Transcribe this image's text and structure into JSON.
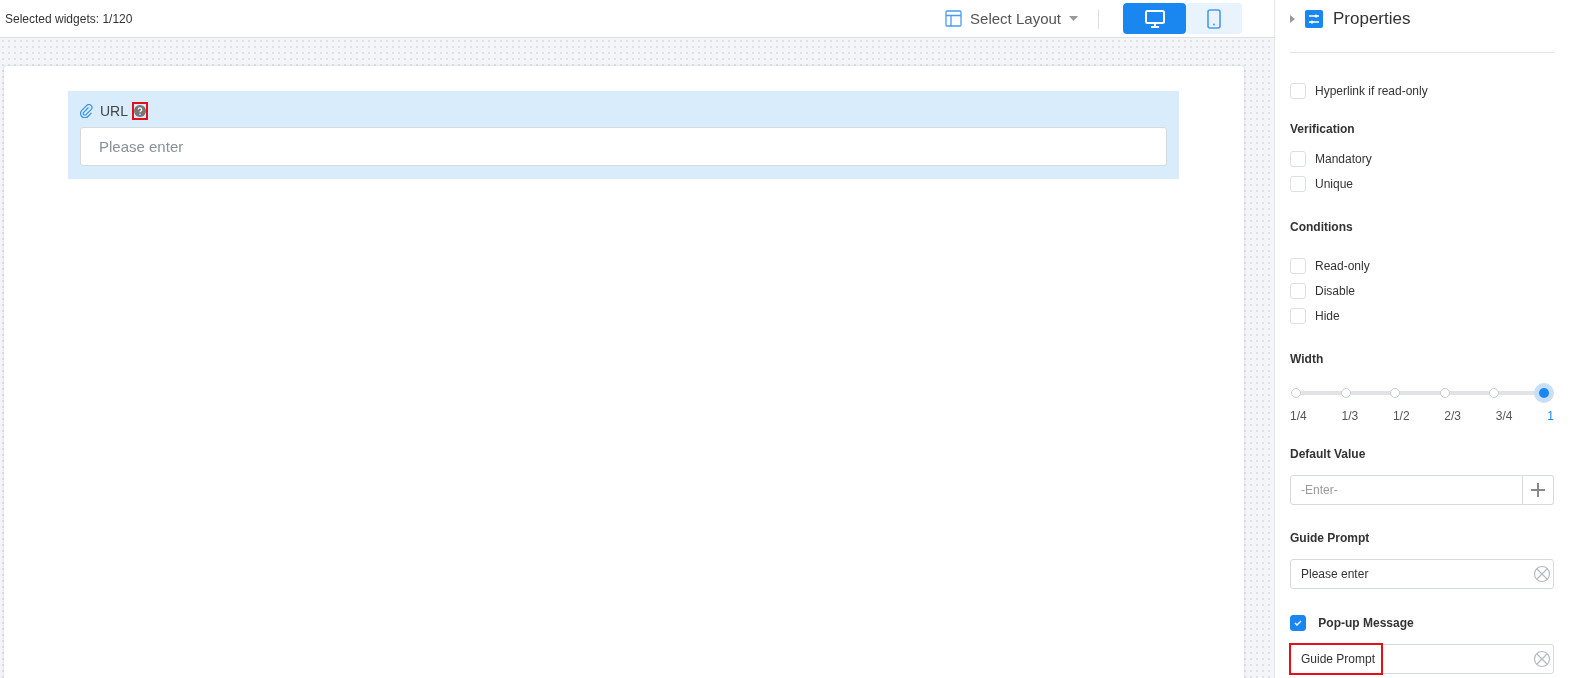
{
  "toolbar": {
    "selection_count": "Selected widgets: 1/120",
    "layout_button": "Select Layout",
    "devices": [
      {
        "kind": "desktop",
        "selected": true
      },
      {
        "kind": "mobile",
        "selected": false
      }
    ]
  },
  "canvas": {
    "field": {
      "label": "URL",
      "help_highlighted": true,
      "placeholder": "Please enter"
    }
  },
  "properties": {
    "title": "Properties",
    "hyperlink": {
      "label": "Hyperlink if read-only",
      "checked": false
    },
    "sections": [
      {
        "title": "Verification",
        "options": [
          {
            "label": "Mandatory",
            "checked": false
          },
          {
            "label": "Unique",
            "checked": false
          }
        ]
      },
      {
        "title": "Conditions",
        "options": [
          {
            "label": "Read-only",
            "checked": false
          },
          {
            "label": "Disable",
            "checked": false
          },
          {
            "label": "Hide",
            "checked": false
          }
        ]
      }
    ],
    "width": {
      "title": "Width",
      "level": 1,
      "stops": [
        {
          "label": "1/4",
          "selected": false
        },
        {
          "label": "1/3",
          "selected": false
        },
        {
          "label": "1/2",
          "selected": false
        },
        {
          "label": "2/3",
          "selected": false
        },
        {
          "label": "3/4",
          "selected": false
        },
        {
          "label": "1",
          "selected": true
        }
      ]
    },
    "default_value": {
      "title": "Default Value",
      "placeholder": "-Enter-"
    },
    "guide_prompt": {
      "title": "Guide Prompt",
      "value": "Please enter"
    },
    "popup_message": {
      "label": "Pop-up Message",
      "checked": true,
      "value": "Guide Prompt",
      "highlighted": true
    }
  }
}
